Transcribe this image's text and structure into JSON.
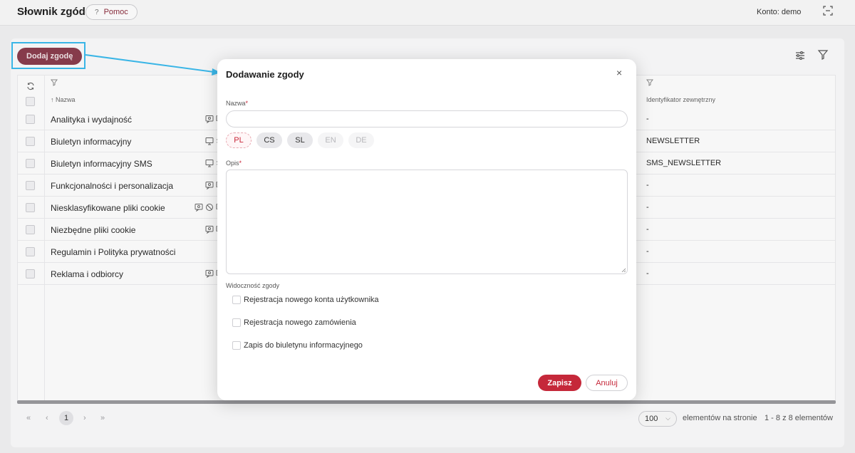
{
  "header": {
    "title": "Słownik zgód",
    "help_label": "Pomoc",
    "help_symbol": "?",
    "account": "Konto: demo"
  },
  "toolbar": {
    "add_label": "Dodaj zgodę"
  },
  "table": {
    "columns": {
      "name": "↑ Nazwa",
      "external_id": "Identyfikator zewnętrzny"
    },
    "rows": [
      {
        "name": "Analityka i wydajność",
        "ext": "-",
        "icons": [
          "consent-icon",
          "monitor-icon"
        ]
      },
      {
        "name": "Biuletyn informacyjny",
        "ext": "NEWSLETTER",
        "icons": [
          "monitor-icon",
          "transfer-icon"
        ]
      },
      {
        "name": "Biuletyn informacyjny SMS",
        "ext": "SMS_NEWSLETTER",
        "icons": [
          "monitor-icon",
          "transfer-icon"
        ]
      },
      {
        "name": "Funkcjonalności i personalizacja",
        "ext": "-",
        "icons": [
          "consent-icon",
          "monitor-icon"
        ]
      },
      {
        "name": "Niesklasyfikowane pliki cookie",
        "ext": "-",
        "icons": [
          "consent-icon",
          "block-icon",
          "monitor-icon"
        ]
      },
      {
        "name": "Niezbędne pliki cookie",
        "ext": "-",
        "icons": [
          "consent-icon",
          "monitor-icon"
        ]
      },
      {
        "name": "Regulamin i Polityka prywatności",
        "ext": "-",
        "icons": []
      },
      {
        "name": "Reklama i odbiorcy",
        "ext": "-",
        "icons": [
          "consent-icon",
          "monitor-icon"
        ]
      }
    ]
  },
  "pager": {
    "first": "«",
    "prev": "‹",
    "current": "1",
    "next": "›",
    "last": "»",
    "per_page": "100",
    "per_page_label": "elementów na stronie",
    "range": "1 - 8 z 8 elementów"
  },
  "modal": {
    "title": "Dodawanie zgody",
    "close": "×",
    "name_label": "Nazwa",
    "required_mark": "*",
    "languages": [
      {
        "code": "PL",
        "state": "active"
      },
      {
        "code": "CS",
        "state": "filled"
      },
      {
        "code": "SL",
        "state": "filled"
      },
      {
        "code": "EN",
        "state": "empty"
      },
      {
        "code": "DE",
        "state": "empty"
      }
    ],
    "description_label": "Opis",
    "visibility_label": "Widoczność zgody",
    "visibility_options": [
      "Rejestracja nowego konta użytkownika",
      "Rejestracja nowego zamówienia",
      "Zapis do biuletynu informacyjnego"
    ],
    "save_label": "Zapisz",
    "cancel_label": "Anuluj"
  },
  "colors": {
    "accent": "#c5283a",
    "add_button": "#8a3c4c",
    "highlight": "#3ab5e6"
  }
}
